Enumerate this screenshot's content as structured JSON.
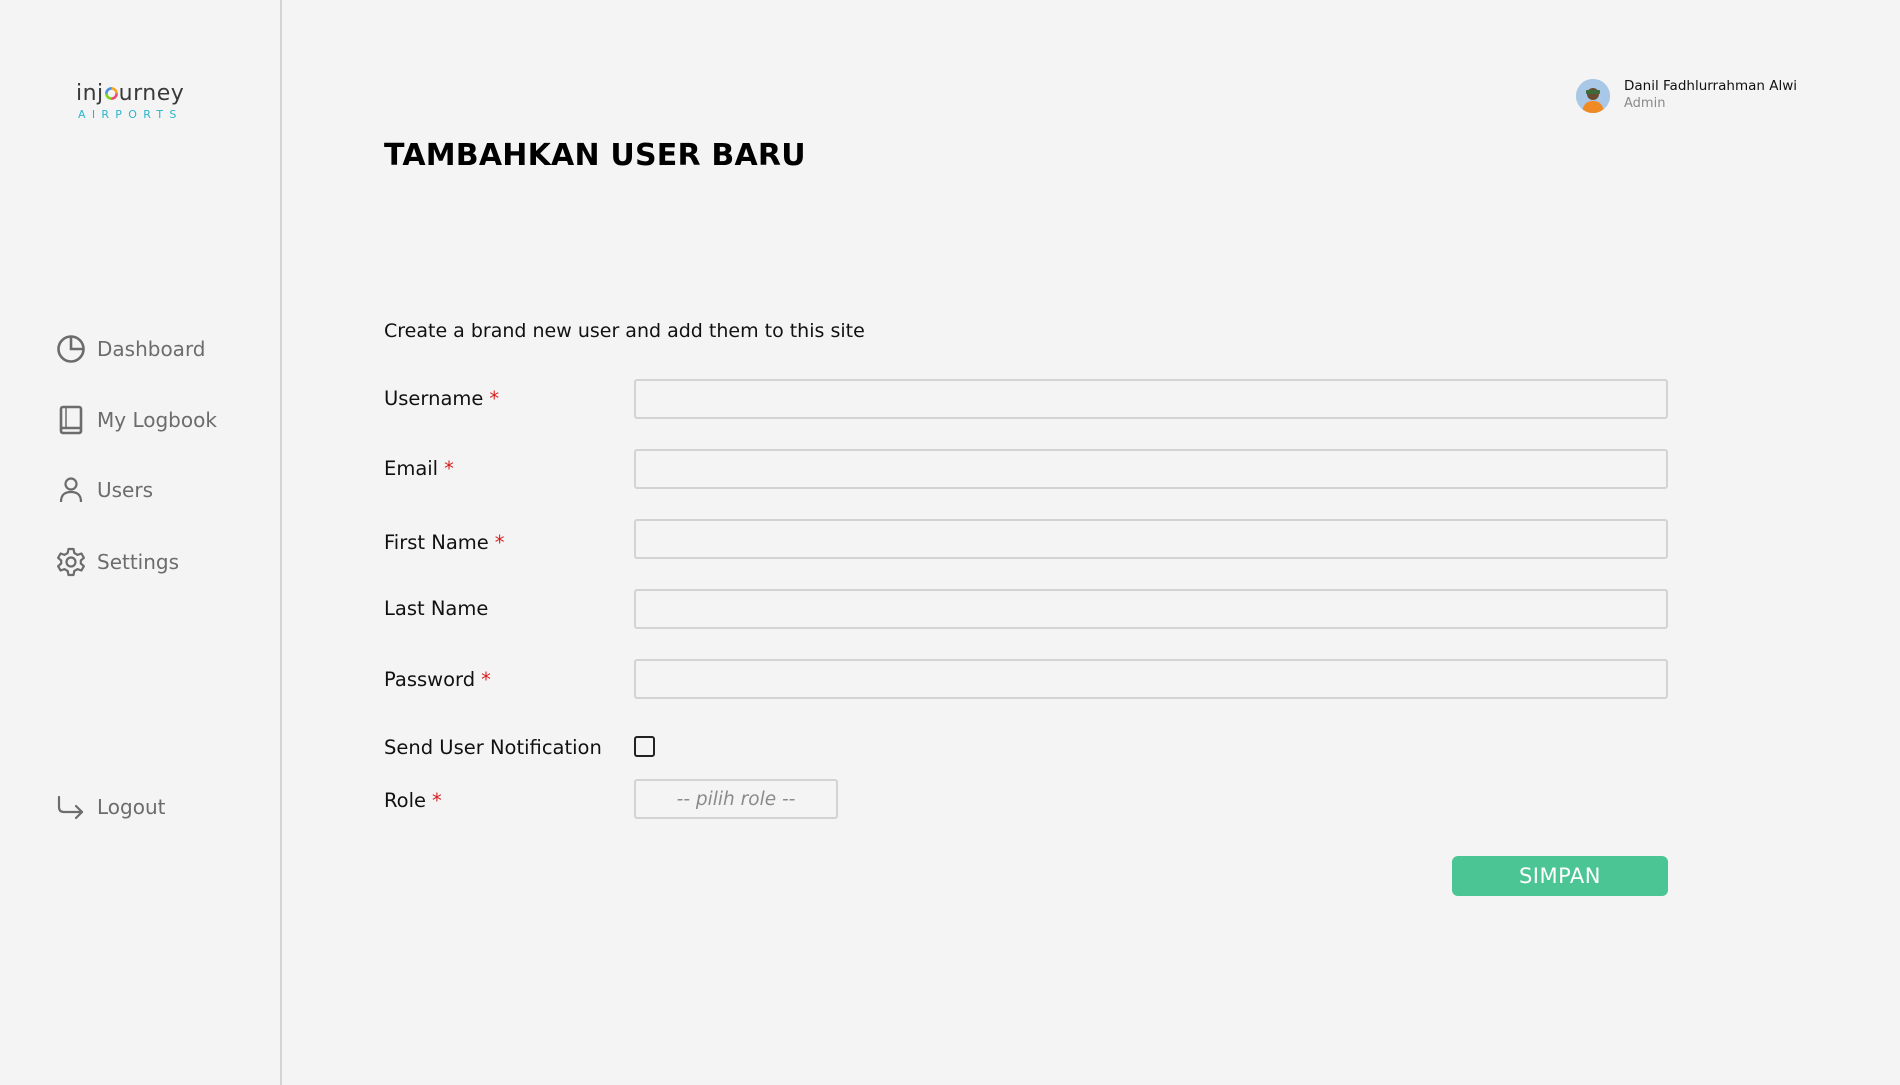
{
  "brand": {
    "name_part1": "inj",
    "name_part2": "urney",
    "subtitle": "AIRPORTS"
  },
  "sidebar": {
    "items": [
      {
        "label": "Dashboard",
        "icon": "pie-chart-icon"
      },
      {
        "label": "My Logbook",
        "icon": "book-icon"
      },
      {
        "label": "Users",
        "icon": "user-icon"
      },
      {
        "label": "Settings",
        "icon": "gear-icon"
      }
    ],
    "logout": {
      "label": "Logout",
      "icon": "logout-arrow-icon"
    }
  },
  "profile": {
    "name": "Danil Fadhlurrahman Alwi",
    "role": "Admin"
  },
  "page": {
    "title": "TAMBAHKAN USER BARU",
    "description": "Create a brand new user and add them to this site"
  },
  "form": {
    "username": {
      "label": "Username",
      "required_mark": "*",
      "value": ""
    },
    "email": {
      "label": "Email",
      "required_mark": "*",
      "value": ""
    },
    "first_name": {
      "label": "First Name",
      "required_mark": "*",
      "value": ""
    },
    "last_name": {
      "label": "Last Name",
      "value": ""
    },
    "password": {
      "label": "Password",
      "required_mark": "*",
      "value": ""
    },
    "send_notification": {
      "label": "Send User Notification",
      "checked": false
    },
    "role": {
      "label": "Role",
      "required_mark": "*",
      "selected": "-- pilih role --"
    },
    "submit_label": "SIMPAN"
  },
  "colors": {
    "accent": "#4bc594",
    "required": "#d71f1f",
    "logo_sub": "#2bb5c9",
    "background": "#f4f4f4"
  }
}
